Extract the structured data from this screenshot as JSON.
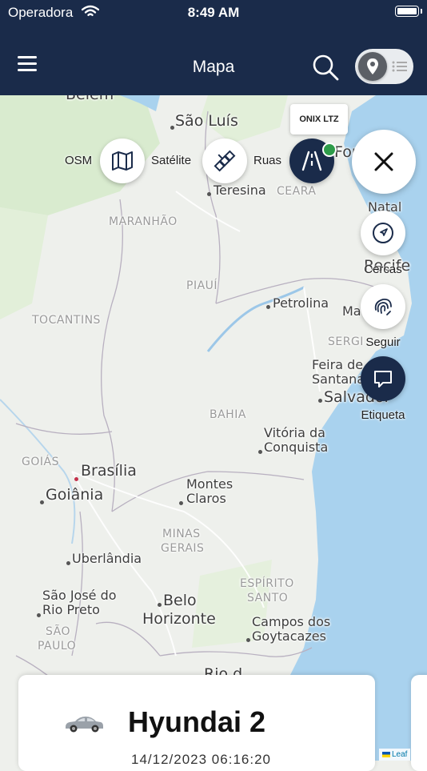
{
  "status_bar": {
    "carrier": "Operadora",
    "time": "8:49 AM"
  },
  "nav": {
    "title": "Mapa"
  },
  "map": {
    "labels": {
      "belem": "Belém",
      "sao_luis": "São Luís",
      "fortaleza": "Fort",
      "teresina": "Teresina",
      "ceara": "CEARA",
      "maranhao": "MARANHÃO",
      "natal": "Natal",
      "recife": "Recife",
      "piaui": "PIAUÍ",
      "tocantins": "TOCANTINS",
      "petrolina": "Petrolina",
      "maceio": "Ma",
      "sergipe": "SERGI",
      "feira1": "Feira de",
      "feira2": "Santana",
      "salvador": "Salvador",
      "bahia": "BAHIA",
      "vitoria1": "Vitória da",
      "vitoria2": "Conquista",
      "goias": "GOIÁS",
      "brasilia": "Brasília",
      "goiania": "Goiânia",
      "montes1": "Montes",
      "montes2": "Claros",
      "minas1": "MINAS",
      "minas2": "GERAIS",
      "uberlandia": "Uberlândia",
      "espirito1": "ESPÍRITO",
      "espirito2": "SANTO",
      "sjrp1": "São José do",
      "sjrp2": "Rio Preto",
      "bh1": "Belo",
      "bh2": "Horizonte",
      "campos1": "Campos dos",
      "campos2": "Goytacazes",
      "sao_paulo1": "SÃO",
      "sao_paulo2": "PAULO",
      "rio": "Rio d"
    },
    "attribution": "Leaf"
  },
  "layers": {
    "osm_label": "OSM",
    "satellite_label": "Satélite",
    "streets_label": "Ruas",
    "tooltip": "ONIX LTZ"
  },
  "actions": {
    "fences_label": "Cercas",
    "follow_label": "Seguir",
    "tag_label": "Etiqueta"
  },
  "vehicle": {
    "name": "Hyundai 2",
    "date": "14/12/2023 06:16:20"
  },
  "colors": {
    "nav": "#1a2b4a",
    "ocean": "#a9d2ee",
    "land": "#eef0ec",
    "accent_green": "#2e9c4a"
  },
  "icons": [
    "menu-icon",
    "search-icon",
    "map-pin-icon",
    "list-icon",
    "map-icon",
    "satellite-icon",
    "road-icon",
    "close-icon",
    "navigation-icon",
    "fingerprint-icon",
    "message-icon",
    "car-icon"
  ]
}
